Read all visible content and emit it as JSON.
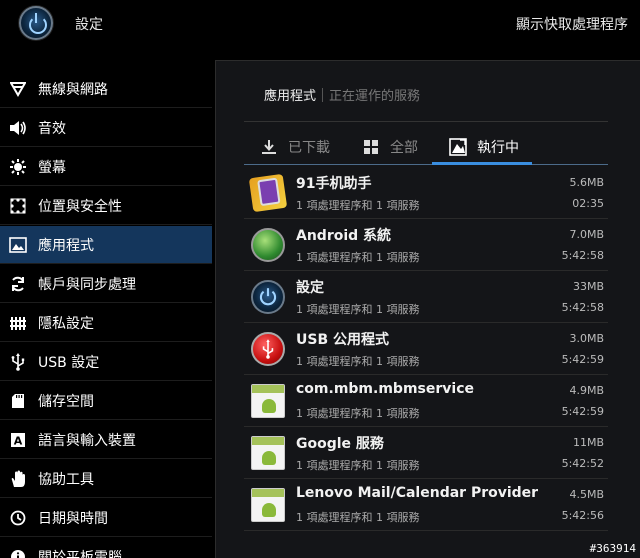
{
  "actionbar": {
    "title": "設定",
    "right_action": "顯示快取處理程序"
  },
  "sidebar": {
    "items": [
      {
        "label": "無線與網路",
        "icon": "wifi-icon"
      },
      {
        "label": "音效",
        "icon": "speaker-icon"
      },
      {
        "label": "螢幕",
        "icon": "brightness-icon"
      },
      {
        "label": "位置與安全性",
        "icon": "grid-lock-icon"
      },
      {
        "label": "應用程式",
        "icon": "apps-icon",
        "active": true
      },
      {
        "label": "帳戶與同步處理",
        "icon": "sync-icon"
      },
      {
        "label": "隱私設定",
        "icon": "privacy-icon"
      },
      {
        "label": "USB 設定",
        "icon": "usb-icon"
      },
      {
        "label": "儲存空間",
        "icon": "sdcard-icon"
      },
      {
        "label": "語言與輸入裝置",
        "icon": "language-icon"
      },
      {
        "label": "協助工具",
        "icon": "hand-icon"
      },
      {
        "label": "日期與時間",
        "icon": "clock-icon"
      },
      {
        "label": "關於平板電腦",
        "icon": "info-icon"
      }
    ]
  },
  "breadcrumb": {
    "current": "應用程式",
    "other": "正在運作的服務"
  },
  "tabs": [
    {
      "label": "已下載",
      "icon": "download-icon"
    },
    {
      "label": "全部",
      "icon": "all-grid-icon"
    },
    {
      "label": "執行中",
      "icon": "running-icon",
      "active": true
    }
  ],
  "apps": [
    {
      "name": "91手机助手",
      "sub": "1 項處理程序和 1 項服務",
      "size": "5.6MB",
      "time": "02:35",
      "icon": "91-assistant-icon"
    },
    {
      "name": "Android 系統",
      "sub": "1 項處理程序和 1 項服務",
      "size": "7.0MB",
      "time": "5:42:58",
      "icon": "android-system-icon"
    },
    {
      "name": "設定",
      "sub": "1 項處理程序和 1 項服務",
      "size": "33MB",
      "time": "5:42:58",
      "icon": "settings-icon"
    },
    {
      "name": "USB 公用程式",
      "sub": "1 項處理程序和 1 項服務",
      "size": "3.0MB",
      "time": "5:42:59",
      "icon": "usb-utility-icon"
    },
    {
      "name": "com.mbm.mbmservice",
      "sub": "1 項處理程序和 1 項服務",
      "size": "4.9MB",
      "time": "5:42:59",
      "icon": "android-package-icon"
    },
    {
      "name": "Google 服務",
      "sub": "1 項處理程序和 1 項服務",
      "size": "11MB",
      "time": "5:42:52",
      "icon": "android-package-icon"
    },
    {
      "name": "Lenovo Mail/Calendar Provider",
      "sub": "1 項處理程序和 1 項服務",
      "size": "4.5MB",
      "time": "5:42:56",
      "icon": "android-package-icon"
    }
  ],
  "watermark": "#363914"
}
